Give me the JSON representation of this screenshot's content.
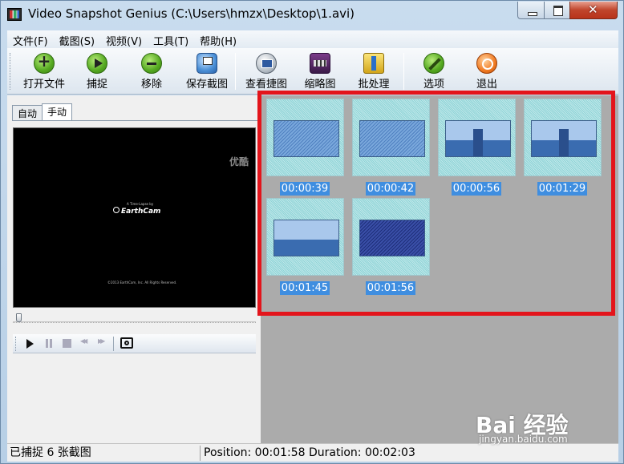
{
  "window": {
    "title": "Video Snapshot Genius (C:\\Users\\hmzx\\Desktop\\1.avi)"
  },
  "menu": [
    "文件(F)",
    "截图(S)",
    "视频(V)",
    "工具(T)",
    "帮助(H)"
  ],
  "toolbar": {
    "open_label": "打开文件",
    "capture_label": "捕捉",
    "remove_label": "移除",
    "save_label": "保存截图",
    "view_label": "查看捷图",
    "thumbnail_label": "缩略图",
    "batch_label": "批处理",
    "options_label": "选项",
    "exit_label": "退出"
  },
  "tabs": [
    "自动",
    "手动"
  ],
  "active_tab": "手动",
  "video": {
    "watermark": "优酷",
    "intro_text": "A Time-Lapse by",
    "logo_text": "EarthCam",
    "copyright": "©2013 EarthCam, Inc. All Rights Reserved."
  },
  "snapshots": [
    {
      "time": "00:00:39"
    },
    {
      "time": "00:00:42"
    },
    {
      "time": "00:00:56"
    },
    {
      "time": "00:01:29"
    },
    {
      "time": "00:01:45"
    },
    {
      "time": "00:01:56"
    }
  ],
  "status": {
    "captured": "已捕捉 6 张截图",
    "position": "Position: 00:01:58 Duration: 00:02:03"
  },
  "watermark": {
    "brand": "Bai 经验",
    "url": "jingyan.baidu.com"
  },
  "colors": {
    "highlight": "#e3141b",
    "time_label_bg": "#3f8ee0",
    "panel_bg": "#ababab"
  }
}
